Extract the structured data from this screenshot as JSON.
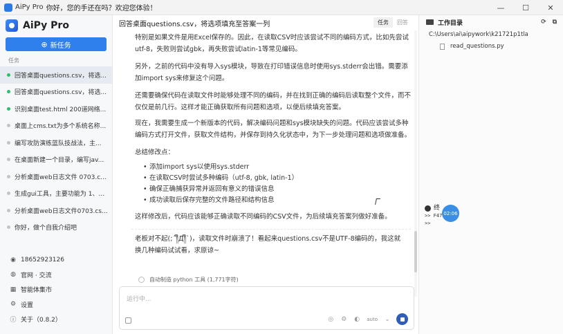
{
  "window": {
    "app_name": "AiPy Pro",
    "title": "你好，您的手还在吗？欢迎您体验！",
    "controls": [
      "minimize",
      "maximize",
      "close"
    ]
  },
  "sidebar": {
    "brand": "AiPy Pro",
    "new_task_label": "新任务",
    "section_label": "任务",
    "tasks": [
      {
        "label": "回答桌面questions.csv，将选...",
        "status": "green"
      },
      {
        "label": "回答桌面questions.csv，将选...",
        "status": "green"
      },
      {
        "label": "识别桌面test.html 200道网络...",
        "status": "green"
      },
      {
        "label": "桌面上cms.txt为多个系统名称...",
        "status": "gray"
      },
      {
        "label": "编写攻防演练蓝队技战法，主...",
        "status": "gray"
      },
      {
        "label": "在桌面新建一个目录，编写jav...",
        "status": "gray"
      },
      {
        "label": "分析桌面web日志文件 0703.c...",
        "status": "gray"
      },
      {
        "label": "生成gui工具，主要功能为 1、...",
        "status": "gray"
      },
      {
        "label": "分析桌面web日志文件0703.cs...",
        "status": "gray"
      },
      {
        "label": "你好，做个自我介绍吧",
        "status": "gray"
      }
    ],
    "bottom_items": [
      {
        "label": "18652923126",
        "icon": "user-icon"
      },
      {
        "label": "官网 · 交流",
        "icon": "globe-icon"
      },
      {
        "label": "智能体集市",
        "icon": "grid-icon"
      },
      {
        "label": "设置",
        "icon": "gear-icon"
      },
      {
        "label": "关于（0.8.2）",
        "icon": "info-icon"
      }
    ]
  },
  "main": {
    "header_title": "回答桌面questions.csv，将选项填充至答案一列",
    "tabs": [
      "任务",
      "回答"
    ],
    "active_tab": 0,
    "paragraphs": [
      "特别是如果文件是用Excel保存的。因此，在读取CSV时应该尝试不同的编码方式，比如先尝试utf-8，失败则尝试gbk，再失败尝试latin-1等常见编码。",
      "另外，之前的代码中没有导入sys模块，导致在打印错误信息时使用sys.stderr会出错。需要添加import sys来修复这个问题。",
      "还需要确保代码在读取文件时能够处理不同的编码，并在找到正确的编码后读取整个文件，而不仅仅是前几行。这样才能正确获取所有问题和选项，以便后续填充答案。",
      "现在，我需要生成一个新版本的代码，解决编码问题和sys模块缺失的问题。代码应该尝试多种编码方式打开文件，获取文件结构，并保存到持久化状态中，为下一步处理问题和选项做准备。",
      "总结修改点："
    ],
    "bullets": [
      "添加import sys以使用sys.stderr",
      "在读取CSV时尝试多种编码（utf-8, gbk, latin-1）",
      "确保正确捕获异常并返回有意义的错误信息",
      "成功读取后保存完整的文件路径和结构信息"
    ],
    "closing": "这样修改后，代码应该能够正确读取不同编码的CSV文件，为后续填充答案列做好准备。",
    "reply": "老板对不起(;´༎ຶД༎ຶ`)，读取文件时崩溃了！看起来questions.csv不是UTF-8编码的，我这就换几种编码试试看，求原谅~",
    "tool_status": "自动制造 python 工具 (1,771字符)",
    "input_placeholder": "运行中...",
    "model_label": "auto"
  },
  "right_panel": {
    "title": "工作目录",
    "path": "C:\\Users\\ai\\aipywork\\k21721p1tla",
    "files": [
      "read_questions.py"
    ],
    "terminal_label": "终",
    "terminal_lines": [
      ">> F47kcmg\"",
      ">>"
    ],
    "recording_time": "02:06"
  }
}
